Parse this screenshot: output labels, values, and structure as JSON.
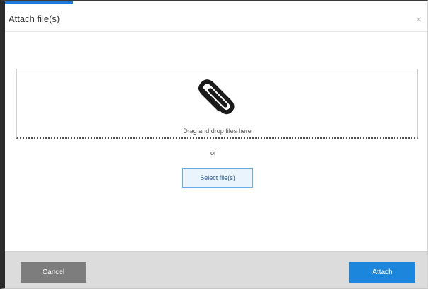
{
  "dialog": {
    "title": "Attach file(s)",
    "close_glyph": "×",
    "accent_color": "#1f7ad8"
  },
  "dropzone": {
    "icon": "paperclip-icon",
    "text": "Drag and drop files here"
  },
  "or_text": "or",
  "select_button": {
    "label": "Select file(s)"
  },
  "footer": {
    "cancel_label": "Cancel",
    "attach_label": "Attach",
    "cancel_color": "#7d7d7d",
    "attach_color": "#1b86dc"
  }
}
